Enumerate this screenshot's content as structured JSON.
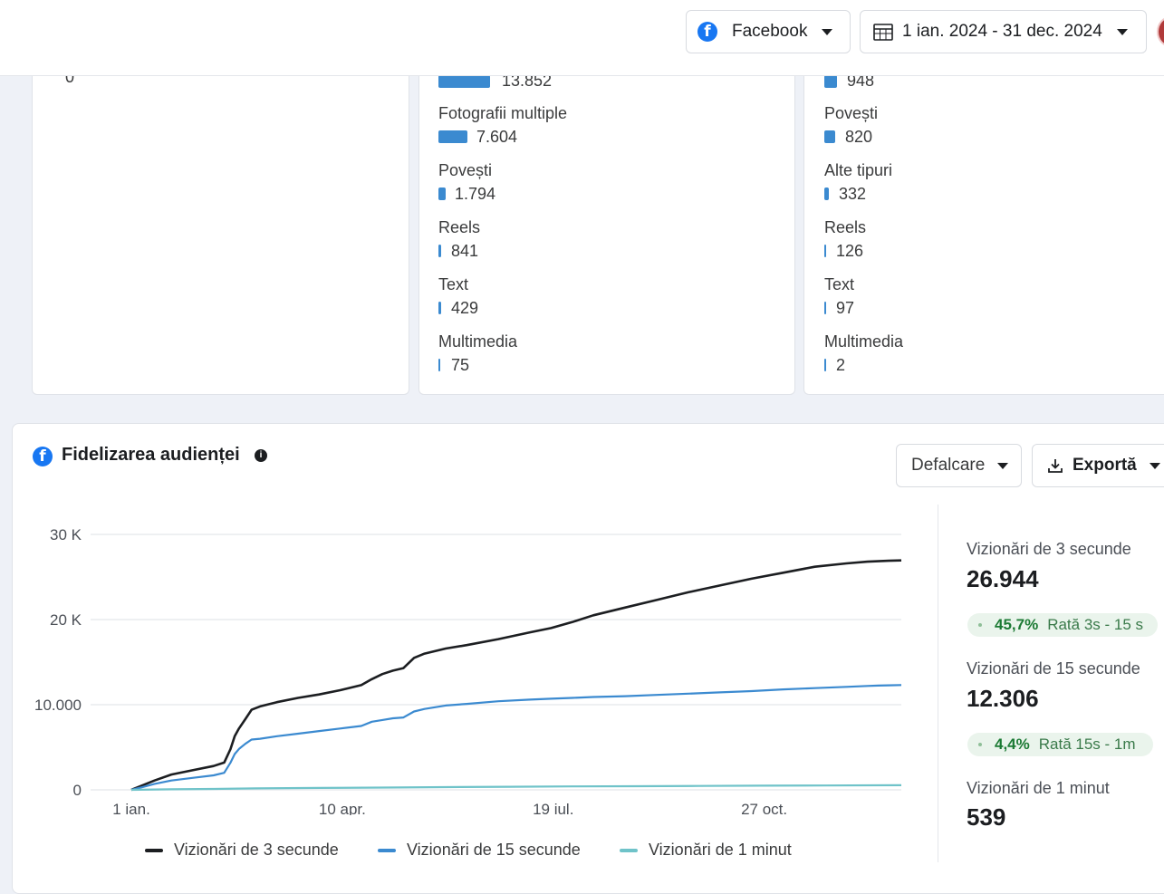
{
  "header": {
    "platform_label": "Facebook",
    "date_range": "1 ian. 2024 - 31 dec. 2024"
  },
  "left_card": {
    "cut_text": "0"
  },
  "middle_card": {
    "top_value": "13.852",
    "items": [
      {
        "label": "Fotografii multiple",
        "value": "7.604",
        "amount": 7604
      },
      {
        "label": "Povești",
        "value": "1.794",
        "amount": 1794
      },
      {
        "label": "Reels",
        "value": "841",
        "amount": 841
      },
      {
        "label": "Text",
        "value": "429",
        "amount": 429
      },
      {
        "label": "Multimedia",
        "value": "75",
        "amount": 75
      }
    ]
  },
  "right_card": {
    "top_value": "948",
    "items": [
      {
        "label": "Povești",
        "value": "820",
        "amount": 820
      },
      {
        "label": "Alte tipuri",
        "value": "332",
        "amount": 332
      },
      {
        "label": "Reels",
        "value": "126",
        "amount": 126
      },
      {
        "label": "Text",
        "value": "97",
        "amount": 97
      },
      {
        "label": "Multimedia",
        "value": "2",
        "amount": 2
      }
    ]
  },
  "retention": {
    "title": "Fidelizarea audienței",
    "breakdown_label": "Defalcare",
    "export_label": "Exportă",
    "stats": [
      {
        "label": "Vizionări de 3 secunde",
        "value": "26.944"
      },
      {
        "label": "Vizionări de 15 secunde",
        "value": "12.306"
      },
      {
        "label": "Vizionări de 1 minut",
        "value": "539"
      }
    ],
    "rates": [
      {
        "pct": "45,7%",
        "label": "Rată 3s - 15 s"
      },
      {
        "pct": "4,4%",
        "label": "Rată 15s - 1m"
      }
    ]
  },
  "colors": {
    "series_3s": "#1c1e21",
    "series_15s": "#3b8ad0",
    "series_1m": "#6fc3c9",
    "facebook_blue": "#1877f2"
  },
  "chart_data": {
    "type": "line",
    "y_tick_labels": [
      "0",
      "10.000",
      "20 K",
      "30 K"
    ],
    "y_ticks": [
      0,
      10000,
      20000,
      30000
    ],
    "ylim": [
      0,
      30000
    ],
    "x_tick_labels": [
      "1 ian.",
      "10 apr.",
      "19 iul.",
      "27 oct."
    ],
    "x_ticks": [
      1,
      101,
      201,
      301
    ],
    "xlim": [
      1,
      366
    ],
    "grid": true,
    "legend_position": "bottom",
    "series": [
      {
        "name": "Vizionări de 3 secunde",
        "x": [
          1,
          6,
          12,
          20,
          30,
          40,
          45,
          48,
          50,
          52,
          55,
          58,
          62,
          70,
          80,
          90,
          100,
          110,
          115,
          120,
          125,
          130,
          135,
          140,
          150,
          160,
          175,
          190,
          200,
          210,
          220,
          235,
          250,
          265,
          280,
          295,
          310,
          325,
          340,
          350,
          355,
          360,
          366
        ],
        "y": [
          0,
          500,
          1100,
          1800,
          2300,
          2800,
          3200,
          4800,
          6300,
          7200,
          8300,
          9400,
          9800,
          10300,
          10800,
          11200,
          11700,
          12300,
          13000,
          13600,
          14000,
          14300,
          15500,
          16000,
          16600,
          17000,
          17700,
          18500,
          19000,
          19700,
          20500,
          21400,
          22300,
          23200,
          24000,
          24800,
          25500,
          26200,
          26600,
          26800,
          26850,
          26900,
          26944
        ]
      },
      {
        "name": "Vizionări de 15 secunde",
        "x": [
          1,
          6,
          12,
          20,
          30,
          40,
          45,
          48,
          50,
          52,
          55,
          58,
          62,
          70,
          80,
          90,
          100,
          110,
          115,
          120,
          125,
          130,
          135,
          140,
          150,
          160,
          175,
          190,
          200,
          210,
          220,
          235,
          250,
          265,
          280,
          295,
          310,
          325,
          340,
          350,
          355,
          360,
          366
        ],
        "y": [
          0,
          300,
          700,
          1100,
          1400,
          1700,
          2000,
          3200,
          4200,
          4800,
          5400,
          5900,
          6000,
          6300,
          6600,
          6900,
          7200,
          7500,
          8000,
          8200,
          8400,
          8500,
          9200,
          9500,
          9900,
          10100,
          10400,
          10600,
          10700,
          10800,
          10900,
          11000,
          11150,
          11300,
          11450,
          11600,
          11800,
          11950,
          12100,
          12200,
          12250,
          12280,
          12306
        ]
      },
      {
        "name": "Vizionări de 1 minut",
        "x": [
          1,
          20,
          40,
          60,
          90,
          120,
          150,
          180,
          210,
          240,
          270,
          300,
          330,
          366
        ],
        "y": [
          0,
          60,
          110,
          170,
          220,
          270,
          320,
          360,
          400,
          430,
          460,
          490,
          515,
          539
        ]
      }
    ]
  }
}
